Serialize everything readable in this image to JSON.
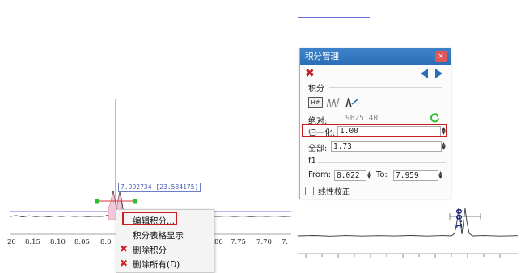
{
  "left_spectrum": {
    "peak_label": "7.992734 [23.584175]",
    "x_ticks": [
      "20",
      "8.15",
      "8.10",
      "8.05",
      "8.0",
      "80",
      "7.75",
      "7.70",
      "7."
    ],
    "integral_value_on_peak": ""
  },
  "context_menu": {
    "items": [
      {
        "label": "编辑积分...",
        "icon": ""
      },
      {
        "label": "积分表格显示",
        "icon": ""
      },
      {
        "label": "删除积分",
        "icon": "delete-x-icon"
      },
      {
        "label": "删除所有(D)",
        "icon": "delete-all-icon"
      }
    ]
  },
  "integral_panel": {
    "title": "积分管理",
    "close_label": "×",
    "section_label": "积分",
    "absolute_label": "绝对:",
    "absolute_value": "9625.40",
    "normalize_label": "归一化:",
    "normalize_value": "1.00",
    "total_label": "全部:",
    "total_value": "1.73",
    "f1_label": "f1",
    "from_label": "From:",
    "from_value": "8.022",
    "to_label": "To:",
    "to_value": "7.959",
    "linear_correction_label": "线性校正",
    "tool_icons": [
      "table-hash-icon",
      "auto-integral-icon",
      "manual-integral-icon"
    ]
  },
  "right_spectrum": {
    "integral_value": "1.00"
  },
  "colors": {
    "accent_blue": "#2a6fb8",
    "highlight_red": "#c81d25",
    "peak_fill": "#f4c6dc",
    "cursor_line": "#6b6fd6",
    "handle_green": "#2bbf2b"
  }
}
